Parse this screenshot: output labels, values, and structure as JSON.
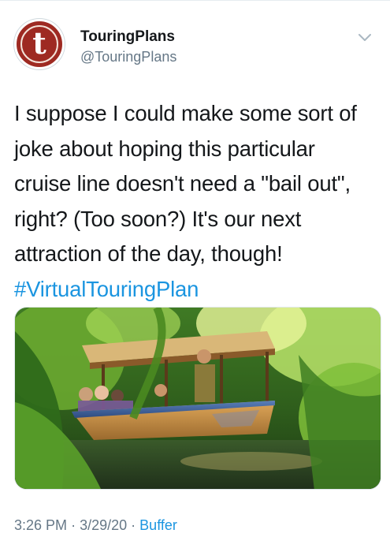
{
  "author": {
    "display_name": "TouringPlans",
    "handle": "@TouringPlans",
    "avatar_letter": "t",
    "avatar_color": "#9e2a22"
  },
  "tweet": {
    "lines": [
      "I suppose I could make some sort of",
      "joke about hoping this particular",
      "cruise line doesn't need a \"bail out\",",
      "right? (Too soon?) It's our next",
      "attraction of the day, though!"
    ],
    "hashtag": "#VirtualTouringPlan"
  },
  "media": {
    "description_icon": "photo-jungle-cruise-boat"
  },
  "meta": {
    "time": "3:26 PM",
    "separator": "·",
    "date": "3/29/20",
    "source": "Buffer"
  },
  "colors": {
    "link": "#1b95e0",
    "secondary_text": "#657786",
    "primary_text": "#14171a"
  }
}
